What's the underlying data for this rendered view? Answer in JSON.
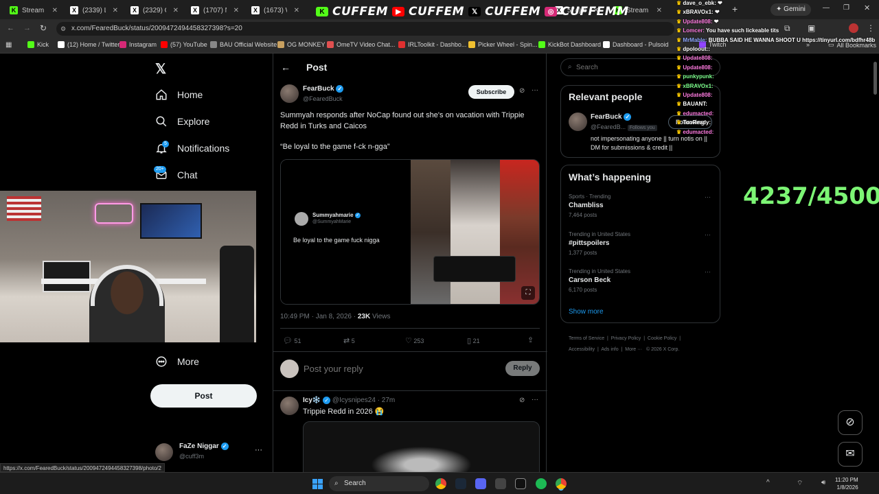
{
  "tabs": [
    {
      "label": "Stream",
      "color": "#53fc18",
      "glyph": "K"
    },
    {
      "label": "(2339) Lou",
      "color": "#ffffff",
      "glyph": "X"
    },
    {
      "label": "(2329) Osc",
      "color": "#ffffff",
      "glyph": "X"
    },
    {
      "label": "(1707) Nin",
      "color": "#ffffff",
      "glyph": "X"
    },
    {
      "label": "(1673) Wo",
      "color": "#ffffff",
      "glyph": "X"
    },
    {
      "label": "574) ban",
      "color": "#ffffff",
      "glyph": "X"
    },
    {
      "label": "Stream - K",
      "color": "#53fc18",
      "glyph": "K"
    }
  ],
  "gemini_label": "Gemini",
  "address": {
    "url": "x.com/FearedBuck/status/2009472494458327398?s=20"
  },
  "bookmarks": [
    {
      "label": "Kick",
      "color": "#53fc18"
    },
    {
      "label": "(12) Home / Twitter",
      "color": "#ffffff"
    },
    {
      "label": "Instagram",
      "color": "#d62976"
    },
    {
      "label": "(57) YouTube",
      "color": "#ff0000"
    },
    {
      "label": "BAU Official Website",
      "color": "#888888"
    },
    {
      "label": "OG MONKEY",
      "color": "#c8a060"
    },
    {
      "label": "OmeTV Video Chat...",
      "color": "#e05050"
    },
    {
      "label": "IRLToolkit - Dashbo...",
      "color": "#e03030"
    },
    {
      "label": "Picker Wheel - Spin...",
      "color": "#f0c030"
    },
    {
      "label": "KickBot Dashboard",
      "color": "#53fc18"
    },
    {
      "label": "Dashboard - Pulsoid",
      "color": "#ffffff"
    },
    {
      "label": "Twitch",
      "color": "#9146ff"
    }
  ],
  "all_bookmarks": "All Bookmarks",
  "overlay": {
    "word": "CUFFEM",
    "word_last": "CUFFEMM",
    "counter": "4237/4500"
  },
  "nav": {
    "home": "Home",
    "explore": "Explore",
    "notifications": "Notifications",
    "notif_badge": "5",
    "chat": "Chat",
    "chat_badge": "20+",
    "more": "More",
    "post": "Post"
  },
  "account": {
    "name": "FaZe Niggar",
    "handle": "@cuff3m"
  },
  "status_url": "https://x.com/FearedBuck/status/2009472494458327398/photo/2",
  "post": {
    "header": "Post",
    "author": "FearBuck",
    "handle": "@FearedBuck",
    "subscribe": "Subscribe",
    "text1": "Summyah responds after NoCap found out she's on vacation with Trippie Redd in Turks and Caicos",
    "text2": "“Be loyal to the game f-ck n-gga”",
    "embed_name": "Summyahmarie",
    "embed_handle": "@SummyahMarie",
    "embed_text": "Be loyal to the game fuck nigga",
    "time": "10:49 PM · Jan 8, 2026 ·",
    "views_count": "23K",
    "views_label": "Views",
    "replies": "51",
    "reposts": "5",
    "likes": "253",
    "bookmarks": "21",
    "reply_placeholder": "Post your reply",
    "reply_button": "Reply"
  },
  "reply": {
    "author": "Icy❄️",
    "handle": "@Icysnipes24 · 27m",
    "text": "Trippie Redd in 2026 😭"
  },
  "search": {
    "placeholder": "Search"
  },
  "relevant": {
    "title": "Relevant people",
    "name": "FearBuck",
    "handle": "@FearedB...",
    "follows_you": "Follows you",
    "follow_label": "Following",
    "bio": "not impersonating anyone || turn notis on || DM for submissions & credit ||"
  },
  "happening": {
    "title": "What’s happening",
    "trends": [
      {
        "category": "Sports · Trending",
        "name": "Chambliss",
        "count": "7,464 posts"
      },
      {
        "category": "Trending in United States",
        "name": "#pittspoilers",
        "count": "1,377 posts"
      },
      {
        "category": "Trending in United States",
        "name": "Carson Beck",
        "count": "6,170 posts"
      }
    ],
    "show_more": "Show more"
  },
  "footer": {
    "links": [
      "Terms of Service",
      "Privacy Policy",
      "Cookie Policy",
      "Accessibility",
      "Ads info",
      "More ···",
      "© 2026 X Corp."
    ]
  },
  "chat": [
    {
      "user": "dave_o_ebk:",
      "msg": "❤",
      "color": "#ffffff"
    },
    {
      "user": "xBRAVOx1:",
      "msg": "❤",
      "color": "#ffffff"
    },
    {
      "user": "Update808:",
      "msg": "❤",
      "color": "#ff7be0"
    },
    {
      "user": "Lomcer:",
      "msg": "You have such lickeable tits",
      "color": "#ff7be0"
    },
    {
      "user": "MrMable:",
      "msg": "BUBBA SAID HE WANNA SHOOT U https://tinyurl.com/bdfhr48b",
      "color": "#8fa8ff"
    },
    {
      "user": "dpoloout::",
      "msg": "",
      "color": "#ffffff"
    },
    {
      "user": "Update808:",
      "msg": "",
      "color": "#ff7be0"
    },
    {
      "user": "Update808:",
      "msg": "",
      "color": "#ff7be0"
    },
    {
      "user": "punkypunk:",
      "msg": "",
      "color": "#7bff8a"
    },
    {
      "user": "xBRAVOx1:",
      "msg": "",
      "color": "#7bff8a"
    },
    {
      "user": "Update808:",
      "msg": "",
      "color": "#ff7be0"
    },
    {
      "user": "BAUANT:",
      "msg": "",
      "color": "#ffffff"
    },
    {
      "user": "edumacted:",
      "msg": "",
      "color": "#ff7be0"
    },
    {
      "user": "TooReady:",
      "msg": "",
      "color": "#ffffff"
    },
    {
      "user": "edumacted:",
      "msg": "",
      "color": "#ff7be0"
    }
  ],
  "taskbar": {
    "search": "Search",
    "time": "11:20 PM",
    "date": "1/8/2026"
  }
}
